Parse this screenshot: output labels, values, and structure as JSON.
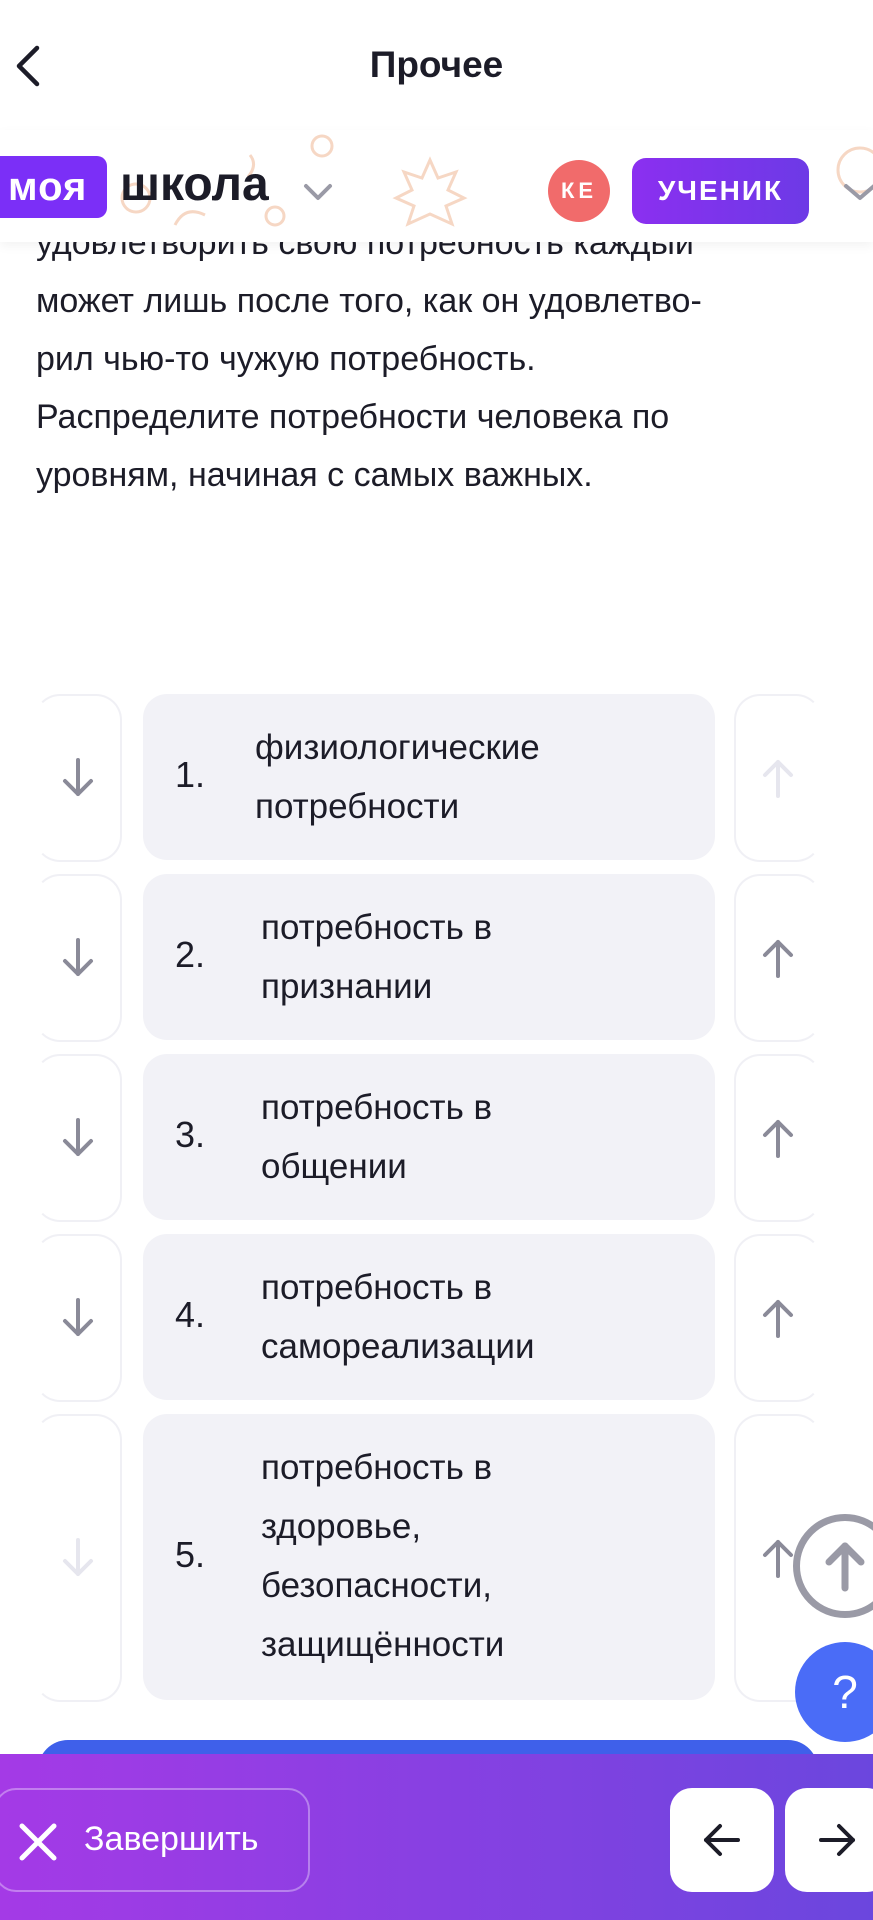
{
  "nav": {
    "title": "Прочее"
  },
  "brand": {
    "logo_part1": "моя",
    "logo_part2": "школа",
    "avatar_initials": "КЕ",
    "role": "УЧЕНИК"
  },
  "question": {
    "lines": [
      "удовлетворить свою потребность каждый",
      "может лишь после того, как он удовлетво-",
      "рил чью-то чужую потребность.",
      "Распределите потребности человека по",
      "уровням, начиная с самых важных."
    ]
  },
  "items": [
    {
      "number": "1.",
      "lines": [
        "физиологические",
        "потребности"
      ],
      "down_enabled": true,
      "up_enabled": false
    },
    {
      "number": "2.",
      "lines": [
        "потребность в",
        "признании"
      ],
      "down_enabled": true,
      "up_enabled": true
    },
    {
      "number": "3.",
      "lines": [
        "потребность в",
        "общении"
      ],
      "down_enabled": true,
      "up_enabled": true
    },
    {
      "number": "4.",
      "lines": [
        "потребность в",
        "самореализации"
      ],
      "down_enabled": true,
      "up_enabled": true
    },
    {
      "number": "5.",
      "lines": [
        "потребность в",
        "здоровье,",
        "безопасности,",
        "защищённости"
      ],
      "down_enabled": false,
      "up_enabled": true
    }
  ],
  "help": {
    "label": "?"
  },
  "footer": {
    "finish_label": "Завершить"
  },
  "colors": {
    "accent_purple": "#7b2ff7",
    "avatar": "#f16b6b",
    "help": "#4a6cf7",
    "card_bg": "#f2f2f7",
    "arrow": "#8a8a98"
  },
  "icons": [
    "back-chevron-icon",
    "chevron-down-icon",
    "arrow-down-icon",
    "arrow-up-icon",
    "close-icon",
    "arrow-left-icon",
    "arrow-right-icon",
    "maple-leaf-icon"
  ]
}
